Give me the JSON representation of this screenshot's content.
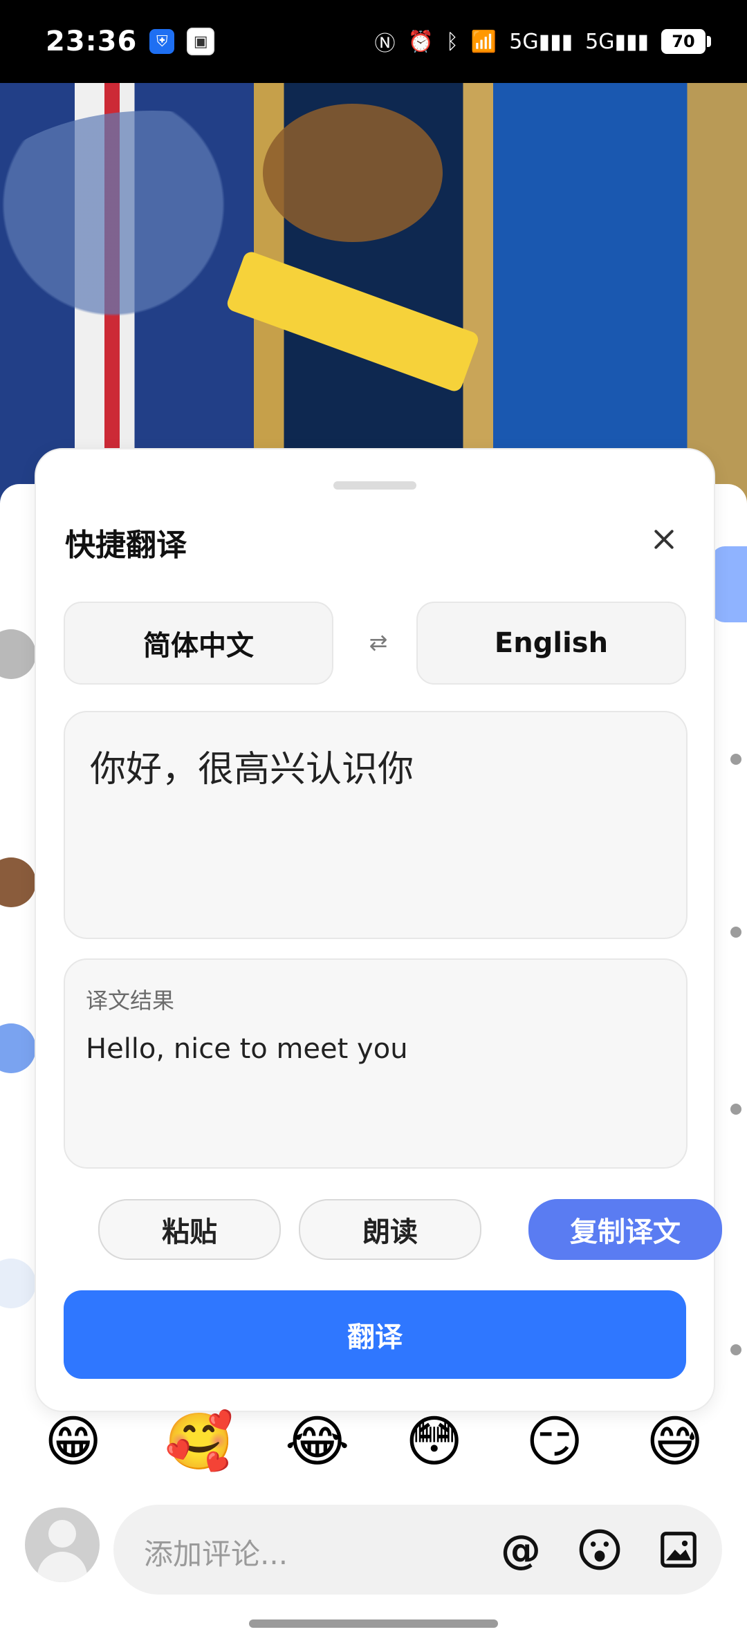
{
  "status_bar": {
    "time": "23:36",
    "battery": "70",
    "icons": [
      "nfc-icon",
      "alarm-icon",
      "bluetooth-icon",
      "wifi-icon",
      "signal-5g-icon",
      "signal-5g-icon"
    ]
  },
  "modal": {
    "title": "快捷翻译",
    "source_language": "简体中文",
    "target_language": "English",
    "input_text": "你好，很高兴认识你",
    "result_label": "译文结果",
    "result_text": "Hello, nice to meet you",
    "buttons": {
      "paste": "粘贴",
      "read": "朗读",
      "copy": "复制译文",
      "translate": "翻译"
    }
  },
  "emoji_bar": [
    "😁",
    "🥰",
    "😂",
    "😳",
    "😏",
    "😅"
  ],
  "comment_bar": {
    "placeholder": "添加评论..."
  },
  "colors": {
    "accent": "#2f77ff",
    "accent_secondary": "#5a7cf2"
  }
}
